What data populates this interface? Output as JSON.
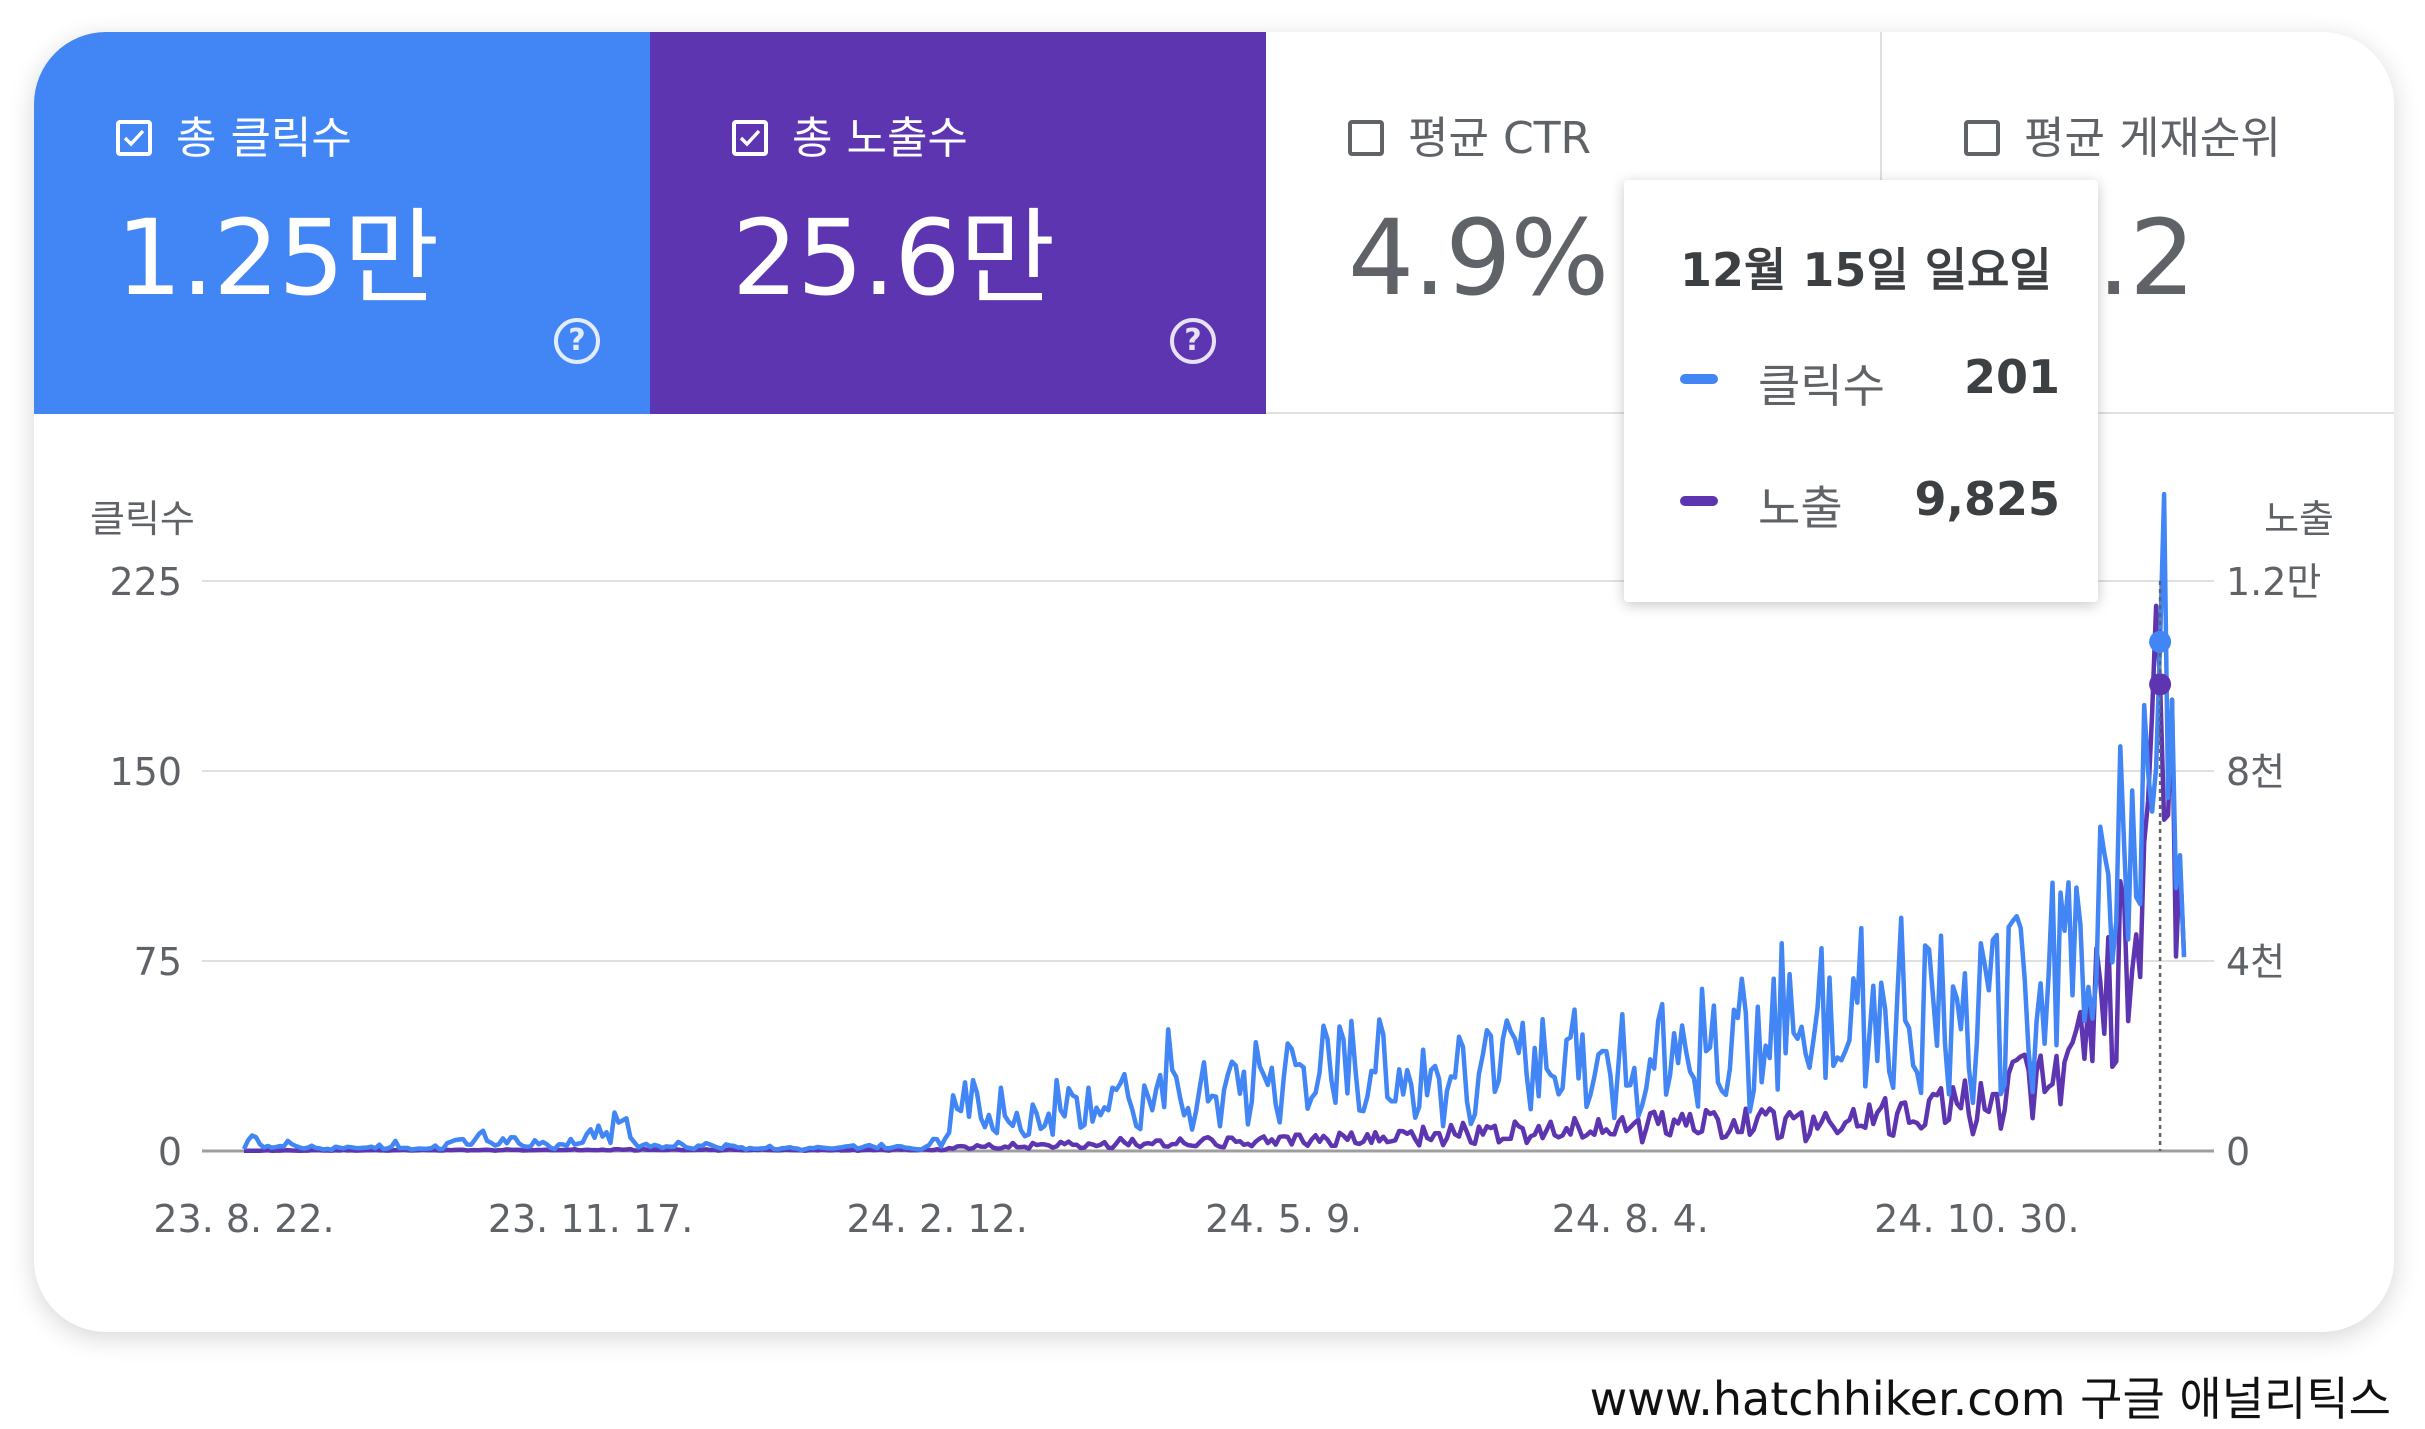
{
  "tiles": [
    {
      "label": "총 클릭수",
      "value": "1.25만",
      "checked": true,
      "help": "?"
    },
    {
      "label": "총 노출수",
      "value": "25.6만",
      "checked": true,
      "help": "?"
    },
    {
      "label": "평균 CTR",
      "value": "4.9%",
      "checked": false,
      "help": "?"
    },
    {
      "label": "평균 게재순위",
      "value": "2.2",
      "checked": false
    }
  ],
  "colors": {
    "clicks": "#4285f4",
    "impressions": "#5e35b1",
    "grid": "#e0e0e0",
    "axis_text": "#5f6368"
  },
  "tooltip": {
    "date": "12월 15일 일요일",
    "rows": [
      {
        "label": "클릭수",
        "value": "201"
      },
      {
        "label": "노출",
        "value": "9,825"
      }
    ]
  },
  "chart_data": {
    "type": "line",
    "title": "",
    "left_axis": {
      "label": "클릭수",
      "ticks": [
        0,
        75,
        150,
        225
      ],
      "tick_labels": [
        "0",
        "75",
        "150",
        "225"
      ],
      "ylim": [
        0,
        225
      ]
    },
    "right_axis": {
      "label": "노출",
      "ticks": [
        0,
        4000,
        8000,
        12000
      ],
      "tick_labels": [
        "0",
        "4천",
        "8천",
        "1.2만"
      ],
      "ylim": [
        0,
        12000
      ]
    },
    "x_ticks": [
      "23. 8. 22.",
      "23. 11. 17.",
      "24. 2. 12.",
      "24. 5. 9.",
      "24. 8. 4.",
      "24. 10. 30."
    ],
    "x_tick_positions": [
      0,
      87,
      174,
      261,
      348,
      435
    ],
    "x_range": [
      0,
      487
    ],
    "highlight_index": 481,
    "series": [
      {
        "name": "클릭수",
        "axis": "left",
        "keypoints": [
          [
            0,
            1
          ],
          [
            2,
            10
          ],
          [
            4,
            2
          ],
          [
            12,
            3
          ],
          [
            20,
            1
          ],
          [
            30,
            2
          ],
          [
            45,
            1
          ],
          [
            60,
            5
          ],
          [
            80,
            2
          ],
          [
            95,
            12
          ],
          [
            100,
            3
          ],
          [
            120,
            2
          ],
          [
            140,
            1
          ],
          [
            160,
            2
          ],
          [
            170,
            1
          ],
          [
            175,
            5
          ],
          [
            180,
            20
          ],
          [
            190,
            10
          ],
          [
            200,
            15
          ],
          [
            215,
            20
          ],
          [
            240,
            25
          ],
          [
            250,
            30
          ],
          [
            265,
            35
          ],
          [
            280,
            40
          ],
          [
            300,
            30
          ],
          [
            320,
            38
          ],
          [
            340,
            40
          ],
          [
            360,
            42
          ],
          [
            380,
            48
          ],
          [
            400,
            50
          ],
          [
            420,
            58
          ],
          [
            435,
            55
          ],
          [
            450,
            70
          ],
          [
            465,
            85
          ],
          [
            470,
            120
          ],
          [
            475,
            130
          ],
          [
            478,
            175
          ],
          [
            481,
            201
          ],
          [
            484,
            170
          ],
          [
            487,
            55
          ]
        ],
        "peaks": [
          [
            38,
            4
          ],
          [
            60,
            8
          ],
          [
            95,
            12
          ],
          [
            178,
            22
          ],
          [
            183,
            28
          ],
          [
            190,
            25
          ],
          [
            204,
            28
          ],
          [
            208,
            22
          ],
          [
            218,
            25
          ],
          [
            232,
            48
          ],
          [
            246,
            24
          ],
          [
            256,
            30
          ],
          [
            266,
            33
          ],
          [
            276,
            44
          ],
          [
            286,
            46
          ],
          [
            296,
            40
          ],
          [
            306,
            41
          ],
          [
            316,
            44
          ],
          [
            326,
            52
          ],
          [
            336,
            46
          ],
          [
            346,
            54
          ],
          [
            356,
            58
          ],
          [
            366,
            64
          ],
          [
            376,
            68
          ],
          [
            386,
            82
          ],
          [
            396,
            80
          ],
          [
            406,
            88
          ],
          [
            416,
            92
          ],
          [
            426,
            85
          ],
          [
            436,
            82
          ],
          [
            446,
            88
          ],
          [
            456,
            102
          ],
          [
            466,
            128
          ],
          [
            472,
            120
          ],
          [
            477,
            176
          ],
          [
            481,
            201
          ],
          [
            484,
            178
          ]
        ]
      },
      {
        "name": "노출",
        "axis": "right",
        "keypoints": [
          [
            0,
            10
          ],
          [
            50,
            20
          ],
          [
            100,
            30
          ],
          [
            150,
            20
          ],
          [
            175,
            30
          ],
          [
            185,
            120
          ],
          [
            200,
            140
          ],
          [
            220,
            200
          ],
          [
            240,
            220
          ],
          [
            260,
            230
          ],
          [
            280,
            280
          ],
          [
            300,
            400
          ],
          [
            320,
            450
          ],
          [
            340,
            500
          ],
          [
            360,
            600
          ],
          [
            380,
            650
          ],
          [
            400,
            700
          ],
          [
            420,
            850
          ],
          [
            440,
            1200
          ],
          [
            455,
            1700
          ],
          [
            465,
            3000
          ],
          [
            472,
            4200
          ],
          [
            476,
            6000
          ],
          [
            478,
            8500
          ],
          [
            481,
            9825
          ],
          [
            484,
            9300
          ],
          [
            487,
            3200
          ]
        ],
        "peaks": [
          [
            200,
            140
          ],
          [
            230,
            220
          ],
          [
            260,
            300
          ],
          [
            290,
            420
          ],
          [
            320,
            520
          ],
          [
            350,
            660
          ],
          [
            380,
            720
          ],
          [
            410,
            810
          ],
          [
            430,
            1000
          ],
          [
            440,
            1200
          ],
          [
            448,
            1700
          ],
          [
            455,
            2000
          ],
          [
            463,
            3100
          ],
          [
            468,
            4500
          ],
          [
            474,
            3800
          ],
          [
            477,
            6500
          ],
          [
            481,
            9825
          ],
          [
            484,
            9500
          ]
        ]
      }
    ]
  },
  "footer": "www.hatchhiker.com 구글 애널리틱스"
}
